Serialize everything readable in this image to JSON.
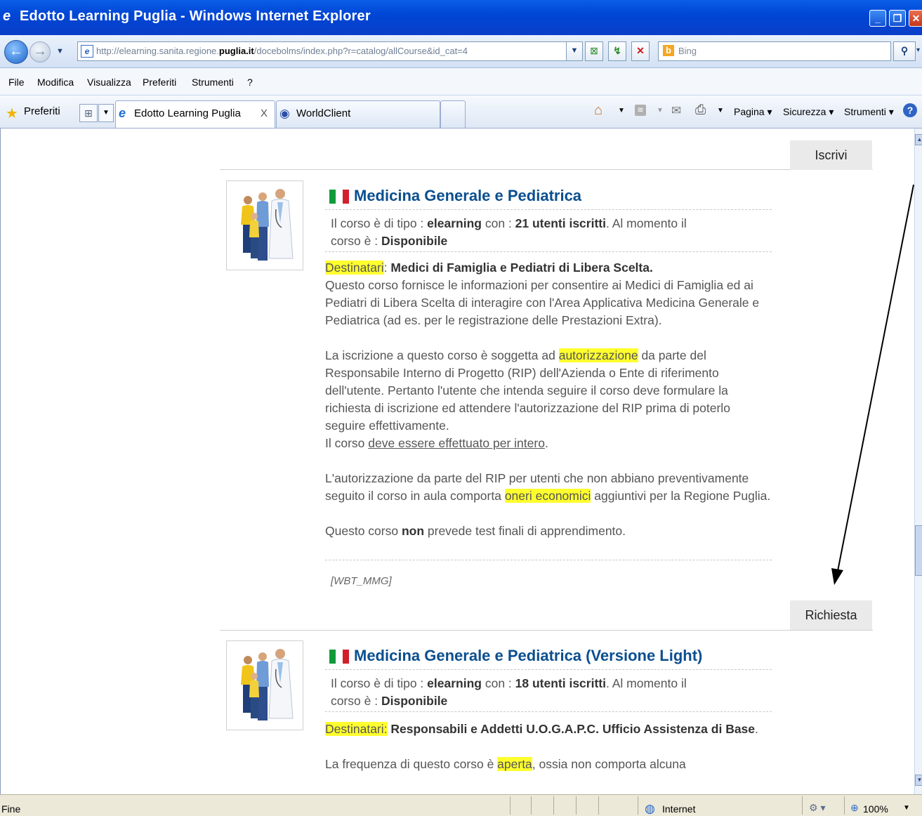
{
  "window": {
    "title": "Edotto Learning Puglia - Windows Internet Explorer"
  },
  "addressbar": {
    "url_prefix": "http://elearning.sanita.regione.",
    "url_domain": "puglia.it",
    "url_suffix": "/docebolms/index.php?r=catalog/allCourse&id_cat=4",
    "search_placeholder": "Bing"
  },
  "menu": [
    "File",
    "Modifica",
    "Visualizza",
    "Preferiti",
    "Strumenti",
    "?"
  ],
  "favorites_label": "Preferiti",
  "tabs": [
    {
      "label": "Edotto Learning Puglia",
      "close": "X"
    },
    {
      "label": "WorldClient"
    }
  ],
  "commandbar": {
    "pagina": "Pagina",
    "sicurezza": "Sicurezza",
    "strumenti": "Strumenti"
  },
  "courses": [
    {
      "action": "Iscrivi",
      "title": "Medicina Generale e Pediatrica",
      "info_a": "Il corso è di tipo : ",
      "info_type": "elearning",
      "info_b": " con : ",
      "info_users": "21 utenti iscritti",
      "info_c": ". Al momento il",
      "info_d": "corso è : ",
      "info_status": "Disponibile",
      "dest_label": "Destinatari",
      "dest_value": "Medici di Famiglia e Pediatri di Libera Scelta.",
      "p1": "Questo corso fornisce le informazioni per consentire ai Medici di Famiglia ed ai Pediatri di Libera Scelta di interagire con l'Area Applicativa Medicina Generale e Pediatrica (ad es. per le registrazione delle Prestazioni Extra).",
      "p2_a": "La iscrizione a questo corso è soggetta ad ",
      "p2_hl": "autorizzazione",
      "p2_b": " da parte del Responsabile Interno di Progetto (RIP) dell'Azienda o Ente di riferimento dell'utente. Pertanto l'utente che intenda seguire il corso deve formulare la richiesta di iscrizione ed attendere l'autorizzazione del RIP prima di poterlo seguire effettivamente.",
      "p2_c": "Il corso ",
      "p2_u": "deve essere effettuato per intero",
      "p2_d": ".",
      "p3_a": "L'autorizzazione da parte del RIP per utenti che non abbiano preventivamente seguito il corso in aula comporta ",
      "p3_hl": "oneri economici",
      "p3_b": " aggiuntivi per la Regione Puglia.",
      "p4_a": "Questo corso ",
      "p4_b": "non",
      "p4_c": " prevede test finali di apprendimento.",
      "code": "[WBT_MMG]"
    },
    {
      "action": "Richiesta",
      "title": "Medicina Generale e Pediatrica (Versione Light)",
      "info_a": "Il corso è di tipo : ",
      "info_type": "elearning",
      "info_b": " con : ",
      "info_users": "18 utenti iscritti",
      "info_c": ". Al momento il",
      "info_d": "corso è : ",
      "info_status": "Disponibile",
      "dest_label": "Destinatari:",
      "dest_value": "Responsabili e Addetti U.O.G.A.P.C. Ufficio Assistenza di Base",
      "dest_end": ".",
      "p1_a": "La frequenza di questo corso è ",
      "p1_hl": "aperta",
      "p1_b": ", ossia non comporta alcuna"
    }
  ],
  "statusbar": {
    "left": "Fine",
    "zone": "Internet",
    "zoom": "100%"
  },
  "colors": {
    "title_bar": "#0a4fd8",
    "course_title": "#0b4f8f",
    "highlight": "#ffff2e"
  }
}
